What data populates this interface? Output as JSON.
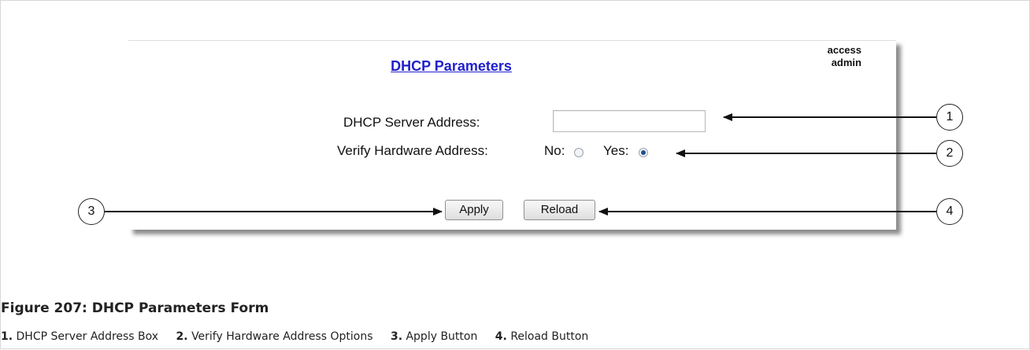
{
  "form": {
    "title": "DHCP Parameters",
    "access_lines": [
      "access",
      "admin"
    ],
    "server_address_label": "DHCP Server Address:",
    "server_address_value": "",
    "verify_label": "Verify Hardware Address:",
    "option_no_label": "No:",
    "option_yes_label": "Yes:",
    "selected_option": "Yes",
    "apply_label": "Apply",
    "reload_label": "Reload"
  },
  "callouts": [
    "1",
    "2",
    "3",
    "4"
  ],
  "figure": {
    "caption": "Figure 207: DHCP Parameters Form",
    "legend": [
      {
        "num": "1.",
        "text": "DHCP Server Address Box"
      },
      {
        "num": "2.",
        "text": "Verify Hardware Address Options"
      },
      {
        "num": "3.",
        "text": "Apply Button"
      },
      {
        "num": "4.",
        "text": "Reload Button"
      }
    ]
  }
}
